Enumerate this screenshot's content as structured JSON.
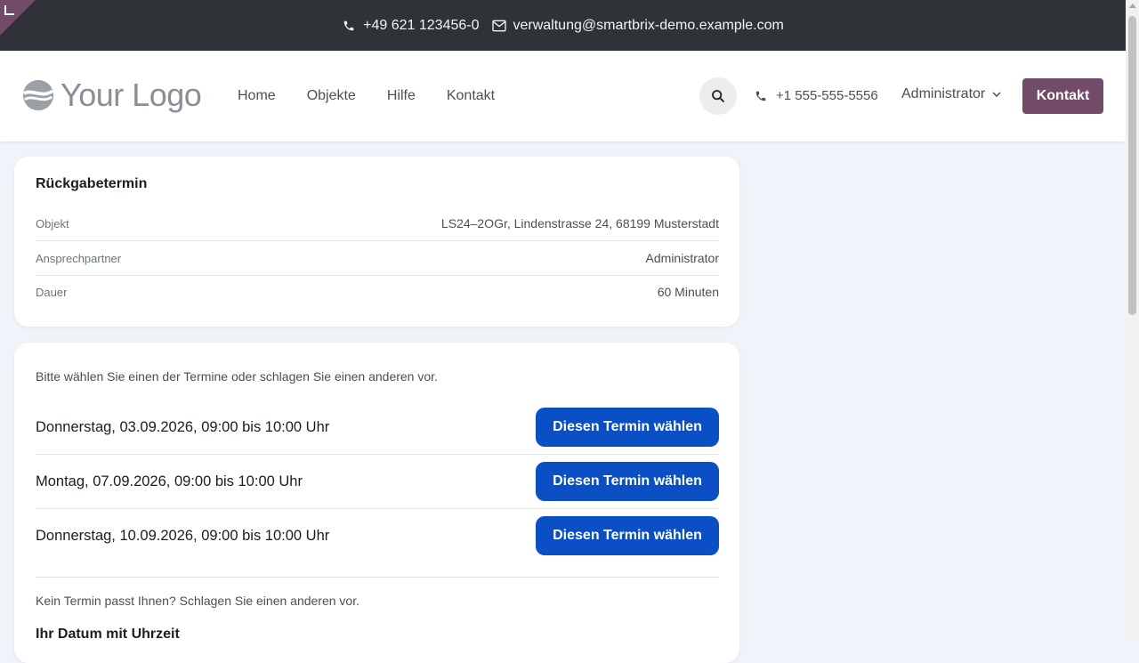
{
  "topbar": {
    "phone": "+49 621 123456-0",
    "email": "verwaltung@smartbrix-demo.example.com"
  },
  "header": {
    "logo_text": "Your Logo",
    "nav": [
      "Home",
      "Objekte",
      "Hilfe",
      "Kontakt"
    ],
    "phone": "+1 555-555-5556",
    "user": "Administrator",
    "cta": "Kontakt"
  },
  "appointment": {
    "title": "Rückgabetermin",
    "rows": [
      {
        "label": "Objekt",
        "value": "LS24–2OGr, Lindenstrasse 24, 68199 Musterstadt"
      },
      {
        "label": "Ansprechpartner",
        "value": "Administrator"
      },
      {
        "label": "Dauer",
        "value": "60 Minuten"
      }
    ]
  },
  "slots": {
    "intro": "Bitte wählen Sie einen der Termine oder schlagen Sie einen anderen vor.",
    "items": [
      {
        "label": "Donnerstag, 03.09.2026, 09:00 bis 10:00 Uhr",
        "button": "Diesen Termin wählen"
      },
      {
        "label": "Montag, 07.09.2026, 09:00 bis 10:00 Uhr",
        "button": "Diesen Termin wählen"
      },
      {
        "label": "Donnerstag, 10.09.2026, 09:00 bis 10:00 Uhr",
        "button": "Diesen Termin wählen"
      }
    ],
    "propose_text": "Kein Termin passt Ihnen? Schlagen Sie einen anderen vor.",
    "date_label": "Ihr Datum mit Uhrzeit"
  },
  "colors": {
    "brand": "#714b67",
    "primary": "#0b4fc4",
    "topbar": "#2f3237",
    "page_bg": "#f1f3fa"
  },
  "icons": [
    "phone-icon",
    "envelope-icon",
    "search-icon",
    "chevron-down-icon",
    "logo-icon",
    "edit-corner-icon"
  ]
}
